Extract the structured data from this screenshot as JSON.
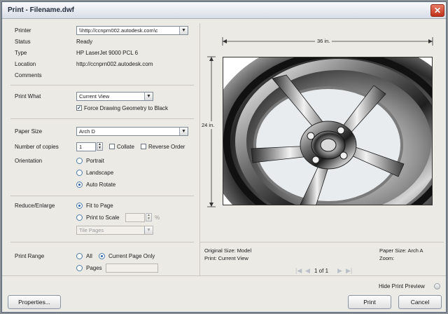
{
  "window": {
    "title": "Print - Filename.dwf",
    "close_glyph": "✕"
  },
  "printer": {
    "label": "Printer",
    "value": "\\\\http://ccnprn002.autodesk.com\\c",
    "status_label": "Status",
    "status": "Ready",
    "type_label": "Type",
    "type": "HP LaserJet 9000 PCL 6",
    "location_label": "Location",
    "location": "http://ccnprn002.autodesk.com",
    "comments_label": "Comments"
  },
  "print_what": {
    "label": "Print What",
    "value": "Current View",
    "force_label": "Force Drawing Geometry to Black",
    "force_checked": true
  },
  "paper": {
    "label": "Paper Size",
    "value": "Arch D"
  },
  "copies": {
    "label": "Number of copies",
    "value": "1",
    "collate_label": "Collate",
    "reverse_label": "Reverse Order"
  },
  "orientation": {
    "label": "Orientation",
    "options": [
      "Portrait",
      "Landscape",
      "Auto Rotate"
    ],
    "selected": "Auto Rotate"
  },
  "reduce": {
    "label": "Reduce/Enlarge",
    "fit_label": "Fit to Page",
    "scale_label": "Print to Scale",
    "percent": "%",
    "tile_label": "Tile Pages",
    "selected": "Fit to Page"
  },
  "range": {
    "label": "Print Range",
    "all_label": "All",
    "current_label": "Current Page Only",
    "pages_label": "Pages",
    "selected": "Current Page Only"
  },
  "preview": {
    "width_label": "36 in.",
    "height_label": "24 in.",
    "original_size": "Original Size: Model",
    "print_label": "Print: Current View",
    "paper_size": "Paper Size: Arch A",
    "zoom": "Zoom:",
    "page_indicator": "1 of 1",
    "hide_label": "Hide Print Preview"
  },
  "buttons": {
    "properties": "Properties...",
    "print": "Print",
    "cancel": "Cancel"
  },
  "icons": {
    "first": "|◀",
    "prev": "◀",
    "next": "▶",
    "last": "▶|",
    "dropdown": "▼",
    "check": "✓",
    "spin_up": "▲",
    "spin_down": "▼"
  }
}
